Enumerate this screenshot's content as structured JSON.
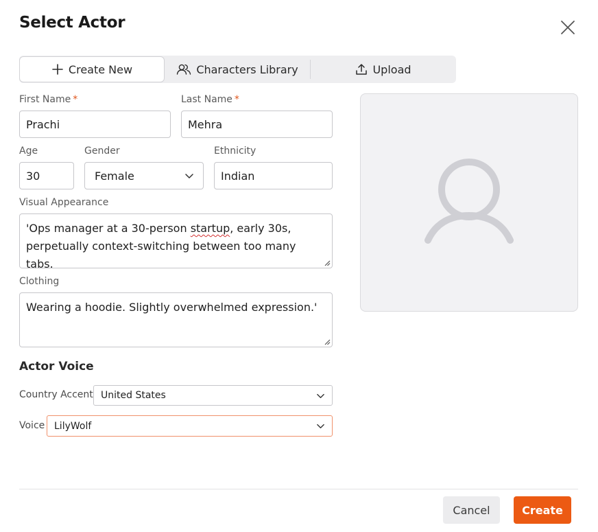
{
  "dialog": {
    "title": "Select Actor"
  },
  "tabs": [
    {
      "label": "Create New",
      "icon": "plus-icon",
      "active": true
    },
    {
      "label": "Characters Library",
      "icon": "users-icon",
      "active": false
    },
    {
      "label": "Upload",
      "icon": "upload-icon",
      "active": false
    }
  ],
  "form": {
    "first_name": {
      "label": "First Name",
      "required": "*",
      "value": "Prachi"
    },
    "last_name": {
      "label": "Last Name",
      "required": "*",
      "value": "Mehra"
    },
    "age": {
      "label": "Age",
      "value": "30"
    },
    "gender": {
      "label": "Gender",
      "value": "Female"
    },
    "ethnicity": {
      "label": "Ethnicity",
      "value": "Indian"
    },
    "visual_appearance": {
      "label": "Visual Appearance",
      "line1_pre": "'Ops manager at a 30-person ",
      "line1_misspelled": "startup",
      "line1_post": ", early 30s,",
      "line2": "perpetually context-switching between too many tabs."
    },
    "clothing": {
      "label": "Clothing",
      "value": "Wearing a hoodie. Slightly overwhelmed expression.'"
    }
  },
  "voice": {
    "section_title": "Actor Voice",
    "country_accent": {
      "label": "Country Accent",
      "value": "United States"
    },
    "voice": {
      "label": "Voice",
      "value": "LilyWolf"
    }
  },
  "preview": {
    "icon": "user-avatar-placeholder-icon"
  },
  "actions": {
    "cancel_label": "Cancel",
    "create_label": "Create"
  },
  "colors": {
    "accent": "#ec5a13",
    "required": "#e0561c",
    "focus_border": "#f0906a",
    "placeholder_icon": "#cfcfd4"
  }
}
